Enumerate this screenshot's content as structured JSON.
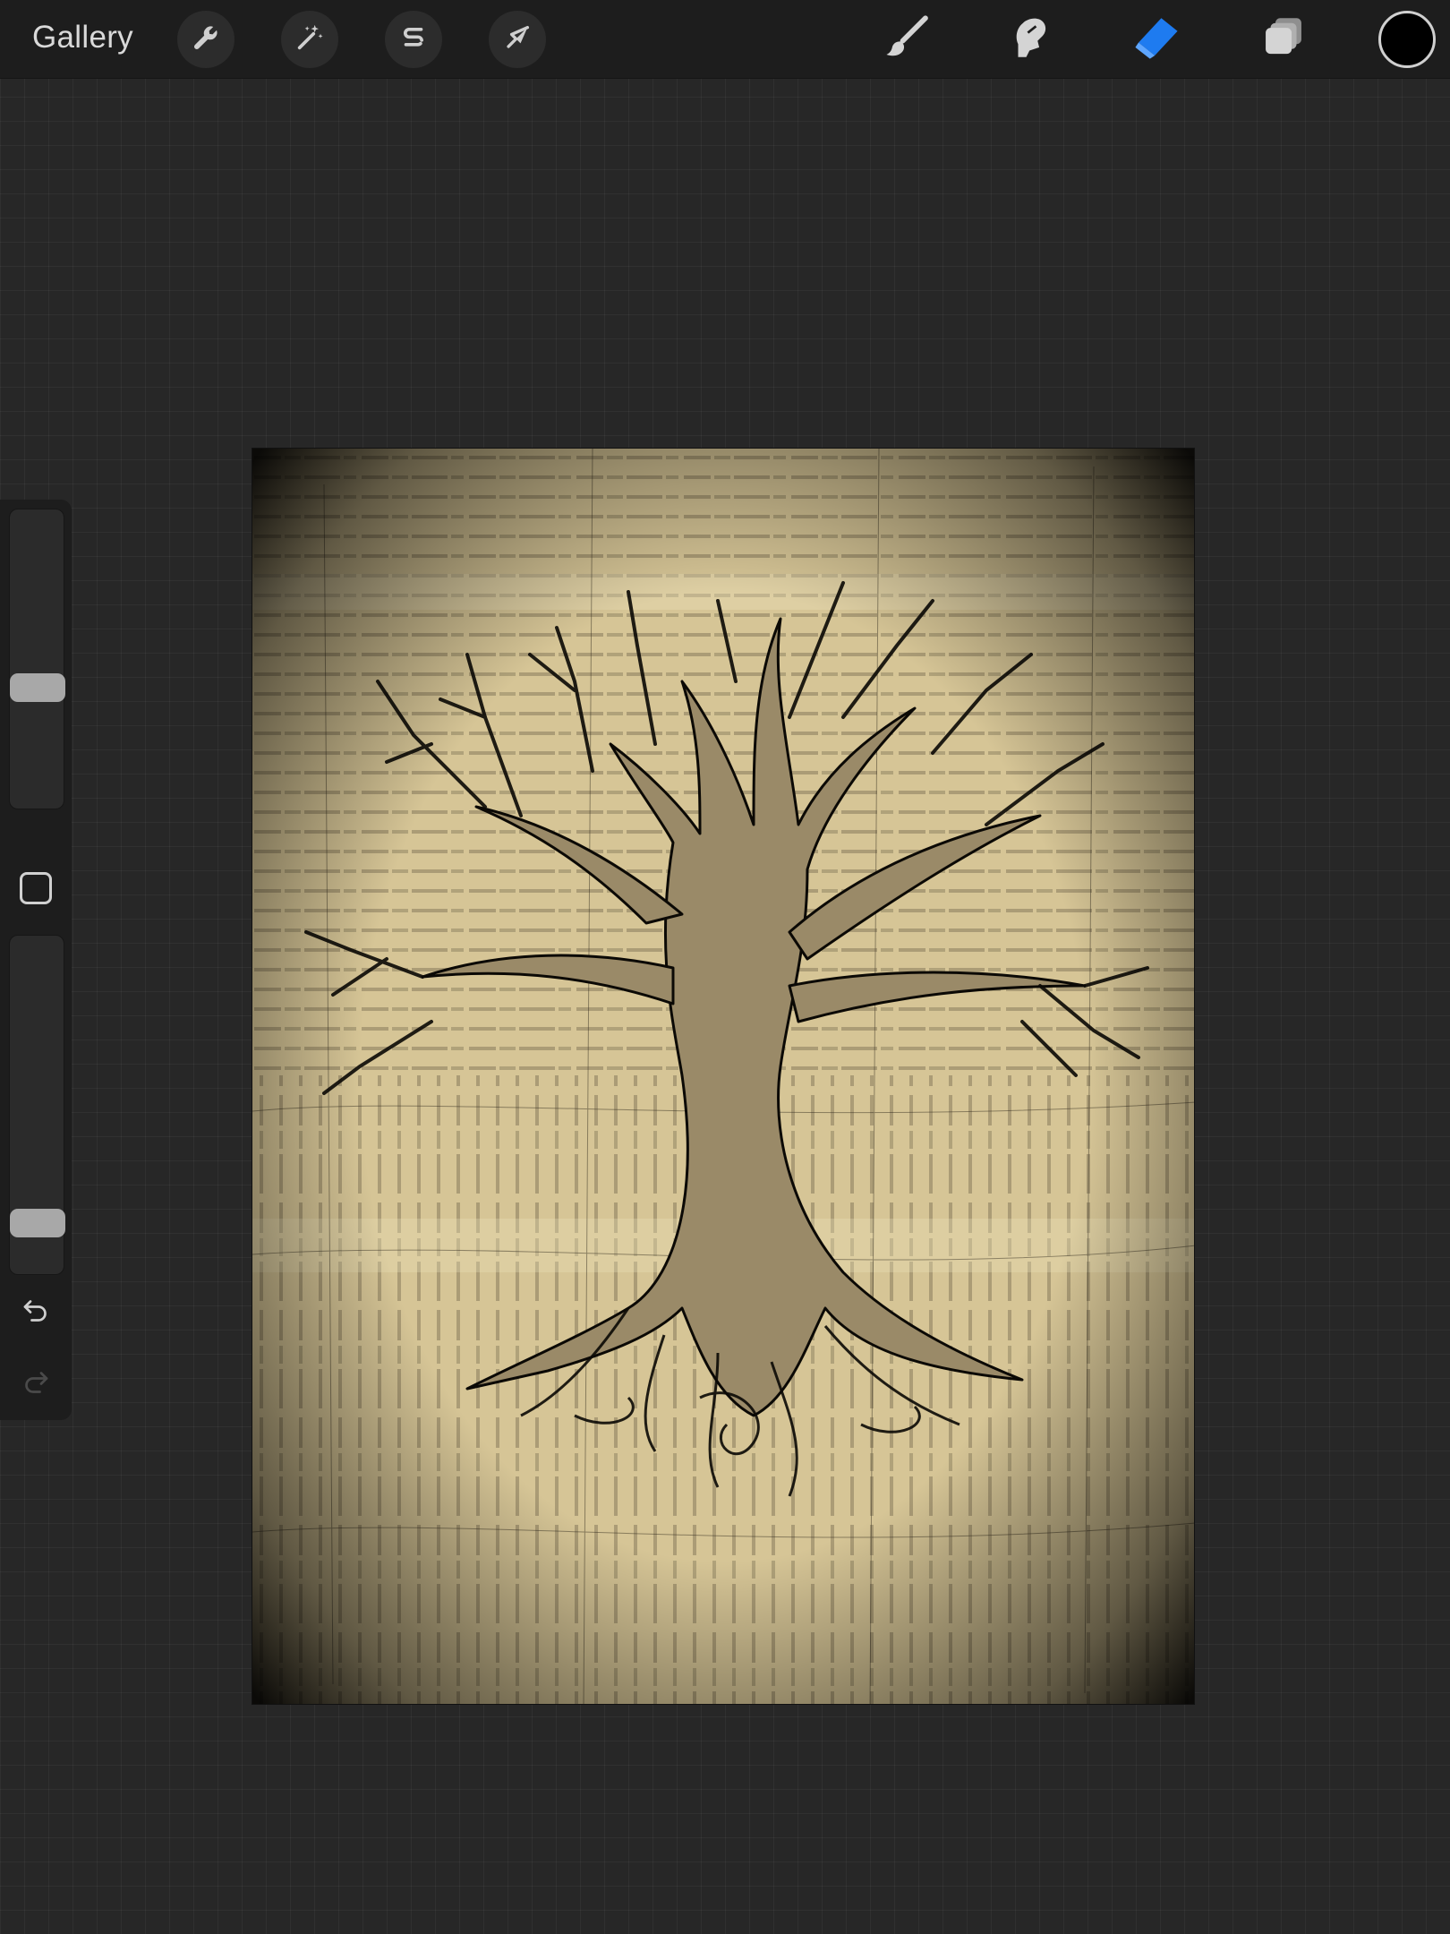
{
  "app": {
    "gallery_label": "Gallery"
  },
  "toolbar": {
    "left_tools": [
      {
        "name": "actions",
        "icon": "wrench-icon"
      },
      {
        "name": "adjustments",
        "icon": "magic-wand-icon"
      },
      {
        "name": "selection",
        "icon": "selection-s-icon"
      },
      {
        "name": "transform",
        "icon": "arrow-cursor-icon"
      }
    ],
    "right_tools": [
      {
        "name": "brush",
        "icon": "brush-icon",
        "active": false
      },
      {
        "name": "smudge",
        "icon": "smudge-finger-icon",
        "active": false
      },
      {
        "name": "eraser",
        "icon": "eraser-icon",
        "active": true
      },
      {
        "name": "layers",
        "icon": "layers-icon",
        "active": false
      }
    ],
    "current_color": "#000000",
    "active_color": "#1e7bf0"
  },
  "sidebar": {
    "brush_size_level": 0.39,
    "opacity_level": 0.11,
    "modify_icon": "square-icon",
    "undo_icon": "undo-arrow-icon",
    "redo_icon": "redo-arrow-icon",
    "redo_enabled": false
  },
  "canvas": {
    "artwork_description_icon": "tree-of-life-artwork",
    "background": "#d9c99c"
  }
}
